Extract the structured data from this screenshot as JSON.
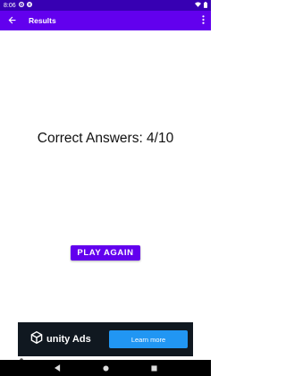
{
  "status_bar": {
    "time": "8:06"
  },
  "app_bar": {
    "title": "Results"
  },
  "main": {
    "result_text": "Correct Answers: 4/10",
    "play_again_label": "PLAY AGAIN"
  },
  "ad": {
    "brand": "unity Ads",
    "cta_label": "Learn more"
  },
  "colors": {
    "primary": "#6200EE",
    "primary_dark": "#3700B3",
    "ad_background": "#101820",
    "ad_button": "#2196F3"
  },
  "icons": [
    "settings-icon",
    "pause-icon",
    "wifi-icon",
    "battery-icon",
    "back-arrow-icon",
    "more-vert-icon",
    "unity-logo-icon",
    "nav-back-icon",
    "nav-home-icon",
    "nav-recents-icon"
  ]
}
